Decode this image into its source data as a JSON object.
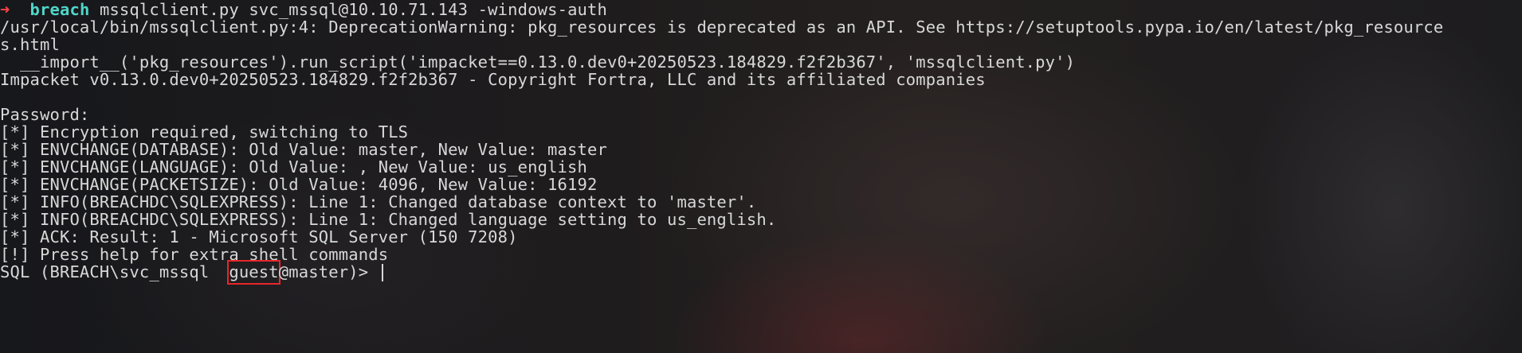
{
  "prompt": {
    "arrow": "➜",
    "host": "breach",
    "command": "mssqlclient.py svc_mssql@10.10.71.143 -windows-auth"
  },
  "output": {
    "warning_line_1": "/usr/local/bin/mssqlclient.py:4: DeprecationWarning: pkg_resources is deprecated as an API. See https://setuptools.pypa.io/en/latest/pkg_resource",
    "warning_line_2": "s.html",
    "warning_line_3": "  __import__('pkg_resources').run_script('impacket==0.13.0.dev0+20250523.184829.f2f2b367', 'mssqlclient.py')",
    "banner": "Impacket v0.13.0.dev0+20250523.184829.f2f2b367 - Copyright Fortra, LLC and its affiliated companies",
    "blank": "",
    "password_prompt": "Password:",
    "log_lines": [
      "[*] Encryption required, switching to TLS",
      "[*] ENVCHANGE(DATABASE): Old Value: master, New Value: master",
      "[*] ENVCHANGE(LANGUAGE): Old Value: , New Value: us_english",
      "[*] ENVCHANGE(PACKETSIZE): Old Value: 4096, New Value: 16192",
      "[*] INFO(BREACHDC\\SQLEXPRESS): Line 1: Changed database context to 'master'.",
      "[*] INFO(BREACHDC\\SQLEXPRESS): Line 1: Changed language setting to us_english.",
      "[*] ACK: Result: 1 - Microsoft SQL Server (150 7208)",
      "[!] Press help for extra shell commands"
    ]
  },
  "sql_prompt": {
    "prefix": "SQL (BREACH\\svc_mssql  ",
    "user": "guest",
    "suffix": "@master)> "
  },
  "colors": {
    "arrow": "#ff4444",
    "host": "#4fd6c8",
    "text": "#d8d8d8",
    "highlight": "#e8262a"
  }
}
